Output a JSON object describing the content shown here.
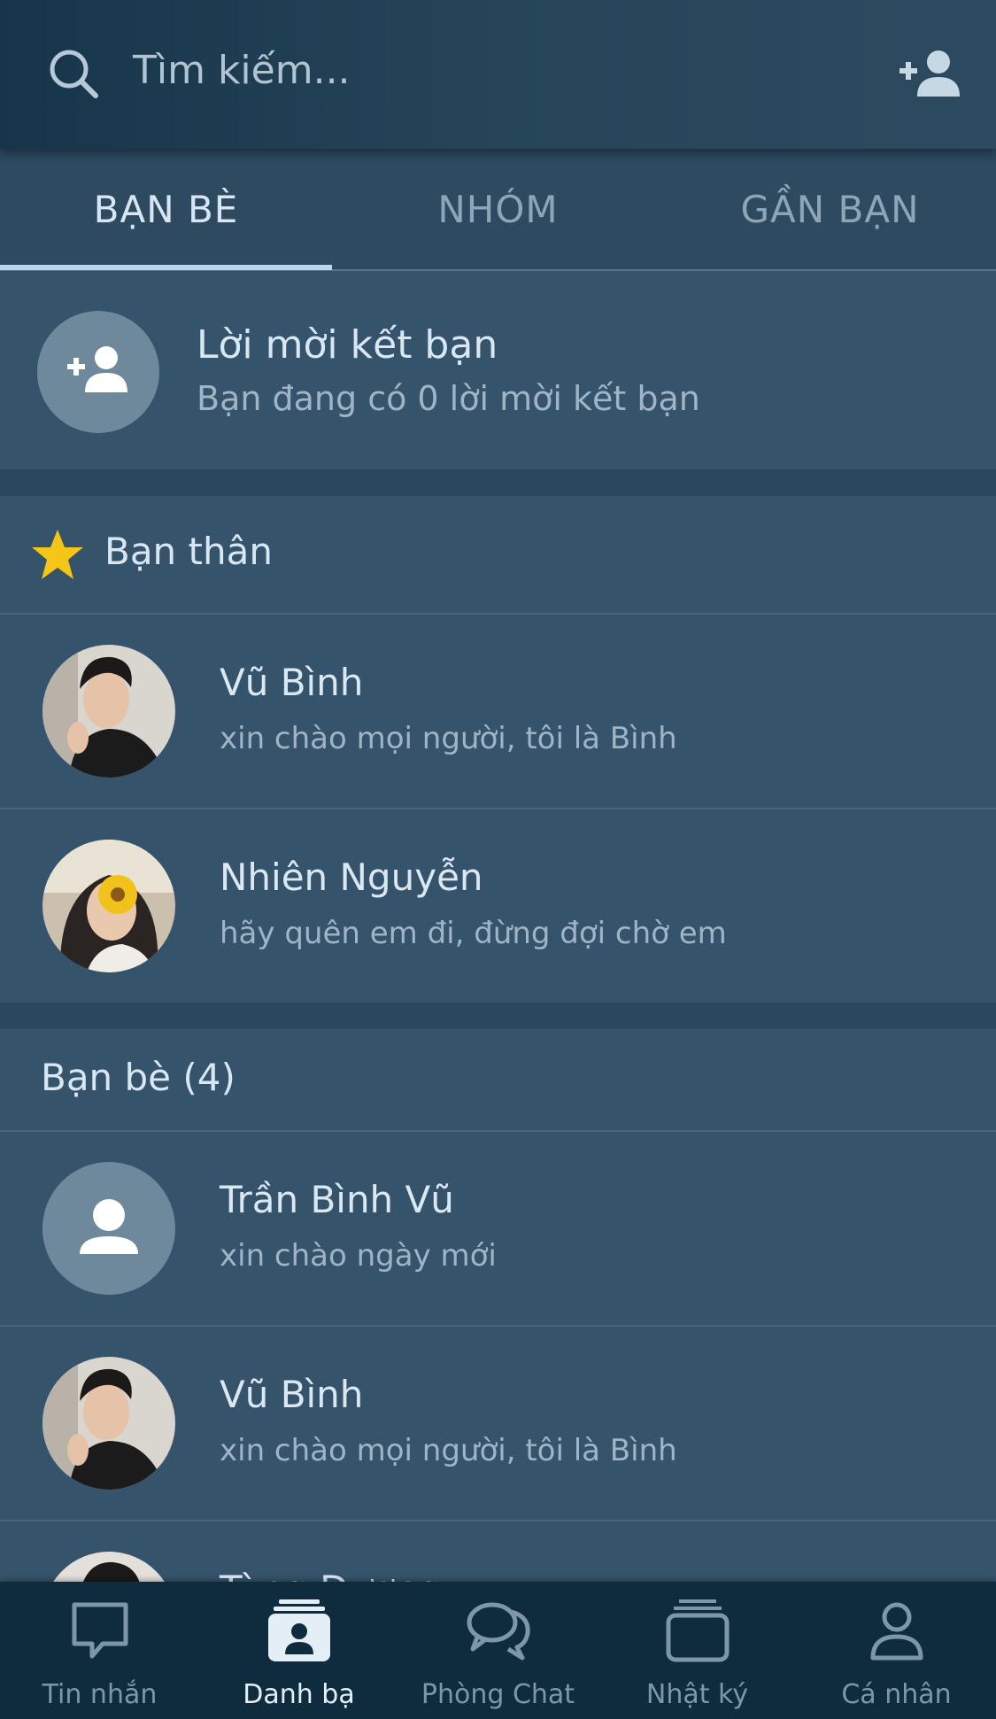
{
  "header": {
    "search_placeholder": "Tìm kiếm...",
    "search_icon": "search-icon",
    "add_friend_icon": "add-friend-icon"
  },
  "tabs": [
    {
      "label": "BẠN BÈ",
      "active": true
    },
    {
      "label": "NHÓM",
      "active": false
    },
    {
      "label": "GẦN BẠN",
      "active": false
    }
  ],
  "friend_request": {
    "title": "Lời mời kết bạn",
    "subtitle": "Bạn đang có 0 lời mời kết bạn",
    "icon": "add-friend-icon"
  },
  "close_friends": {
    "title": "Bạn thân",
    "icon": "star-icon",
    "items": [
      {
        "name": "Vũ Bình",
        "status": "xin chào mọi người, tôi là Bình",
        "avatar": "photo-man"
      },
      {
        "name": "Nhiên Nguyễn",
        "status": "hãy quên em đi, đừng đợi chờ em",
        "avatar": "photo-woman-flower"
      }
    ]
  },
  "friends": {
    "title": "Bạn bè (4)",
    "items": [
      {
        "name": "Trần Bình Vũ",
        "status": "xin chào ngày mới",
        "avatar": "default-user-icon"
      },
      {
        "name": "Vũ Bình",
        "status": "xin chào mọi người, tôi là Bình",
        "avatar": "photo-man"
      },
      {
        "name": "Tùng Dương",
        "status": "",
        "avatar": "photo-man-2"
      }
    ]
  },
  "bottom_nav": [
    {
      "label": "Tin nhắn",
      "icon": "chat-bubble-icon",
      "active": false
    },
    {
      "label": "Danh bạ",
      "icon": "contacts-icon",
      "active": true
    },
    {
      "label": "Phòng Chat",
      "icon": "chat-room-icon",
      "active": false
    },
    {
      "label": "Nhật ký",
      "icon": "timeline-icon",
      "active": false
    },
    {
      "label": "Cá nhân",
      "icon": "person-icon",
      "active": false
    }
  ],
  "colors": {
    "background": "#35536a",
    "header": "#17354a",
    "tab_indicator": "#b9d6ea",
    "star": "#f5c518",
    "bottom_nav": "#0f2c3f"
  }
}
